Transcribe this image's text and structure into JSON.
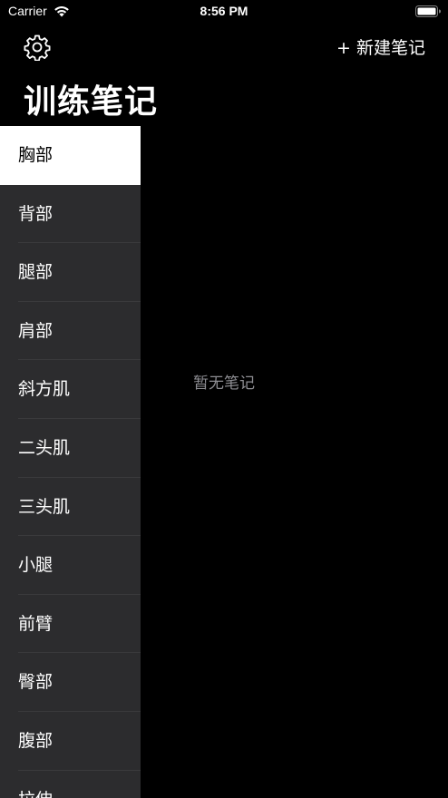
{
  "status_bar": {
    "carrier": "Carrier",
    "time": "8:56 PM"
  },
  "header": {
    "title": "训练笔记",
    "new_note_label": "+ 新建笔记",
    "settings_icon": "gear-icon"
  },
  "sidebar": {
    "selected_index": 0,
    "items": [
      {
        "label": "胸部"
      },
      {
        "label": "背部"
      },
      {
        "label": "腿部"
      },
      {
        "label": "肩部"
      },
      {
        "label": "斜方肌"
      },
      {
        "label": "二头肌"
      },
      {
        "label": "三头肌"
      },
      {
        "label": "小腿"
      },
      {
        "label": "前臂"
      },
      {
        "label": "臀部"
      },
      {
        "label": "腹部"
      },
      {
        "label": "拉伸"
      }
    ]
  },
  "main": {
    "empty_text": "暂无笔记"
  },
  "colors": {
    "background": "#000000",
    "sidebar_background": "#2c2c2e",
    "selected_background": "#ffffff",
    "empty_text": "#8e8e93"
  }
}
